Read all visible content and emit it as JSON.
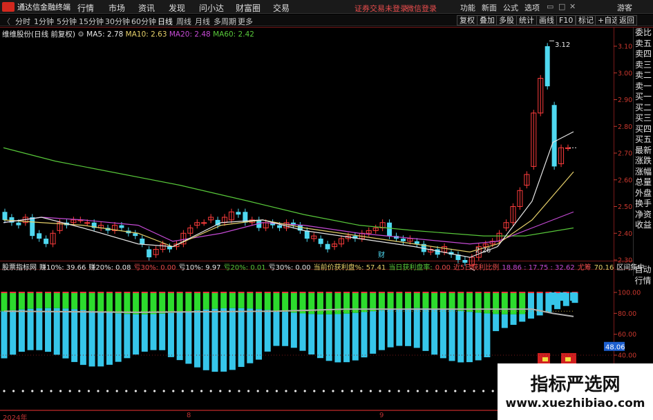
{
  "app": {
    "title": "通达信金融终端"
  },
  "menu": [
    "行情",
    "市场",
    "资讯",
    "发现",
    "问小达",
    "财富圈",
    "交易"
  ],
  "login_text": "证券交易未登录",
  "login_link": "微信登录",
  "menu_right": [
    "功能",
    "新面",
    "公式",
    "选项"
  ],
  "guest": "游客",
  "periods": [
    "分时",
    "1分钟",
    "5分钟",
    "15分钟",
    "30分钟",
    "60分钟",
    "日线",
    "周线",
    "月线",
    "多周期",
    "更多"
  ],
  "active_period": "日线",
  "right_tools": [
    "复权",
    "叠加",
    "多股",
    "统计",
    "画线",
    "F10",
    "标记",
    "+自选",
    "返回"
  ],
  "stock_legend": {
    "name": "维维股份(日线 前复权)",
    "ma5": "MA5: 2.78",
    "ma10": "MA10: 2.63",
    "ma20": "MA20: 2.48",
    "ma60": "MA60: 2.42",
    "colors": {
      "ma5": "#e8e8e8",
      "ma10": "#e6d06a",
      "ma20": "#c64bd6",
      "ma60": "#58c83a"
    }
  },
  "price_axis": [
    "3.10",
    "3.00",
    "2.90",
    "2.80",
    "2.70",
    "2.60",
    "2.50",
    "2.40",
    "2.30"
  ],
  "annotations": {
    "high": "3.12",
    "low": "2.26",
    "marker": "财"
  },
  "right_panel": [
    "委比",
    "卖五",
    "卖四",
    "卖三",
    "卖二",
    "卖一",
    "买一",
    "买二",
    "买三",
    "买四",
    "买五",
    "最新",
    "涨跌",
    "涨幅",
    "总量",
    "外盘",
    "换手",
    "净资",
    "收益"
  ],
  "right_panel2": [
    "自动",
    "行情"
  ],
  "indicator_legend": [
    {
      "t": "股票指标网",
      "c": "#e8e8e8"
    },
    {
      "t": "赚10%: 39.66",
      "c": "#e8e8e8"
    },
    {
      "t": "赚20%: 0.08",
      "c": "#e8e8e8"
    },
    {
      "t": "亏30%: 0.00",
      "c": "#e84c4c"
    },
    {
      "t": "亏10%: 9.97",
      "c": "#e8e8e8"
    },
    {
      "t": "亏20%: 0.01",
      "c": "#58c83a"
    },
    {
      "t": "亏30%: 0.00",
      "c": "#e8e8e8"
    },
    {
      "t": "当前价获利盘%: 57.41",
      "c": "#e6d06a"
    },
    {
      "t": "当日获利盘率:",
      "c": "#58c83a"
    },
    {
      "t": "0.00",
      "c": "#e84c4c"
    },
    {
      "t": "近5日获利比例",
      "c": "#e84c4c"
    },
    {
      "t": "18.86 : 17.75 : 32.62",
      "c": "#c64bd6"
    },
    {
      "t": "尤筹",
      "c": "#e84c4c"
    },
    {
      "t": "70.16",
      "c": "#e6d06a"
    },
    {
      "t": "区间集中",
      "c": "#e8e8e8"
    }
  ],
  "ind_axis": [
    "100.00",
    "80.00",
    "60.00",
    "40.00"
  ],
  "ind_value": "48.06",
  "dates": [
    "2024年",
    "8",
    "9"
  ],
  "watermark": {
    "title": "指标严选网",
    "url": "www.xuezhibiao.com"
  }
}
